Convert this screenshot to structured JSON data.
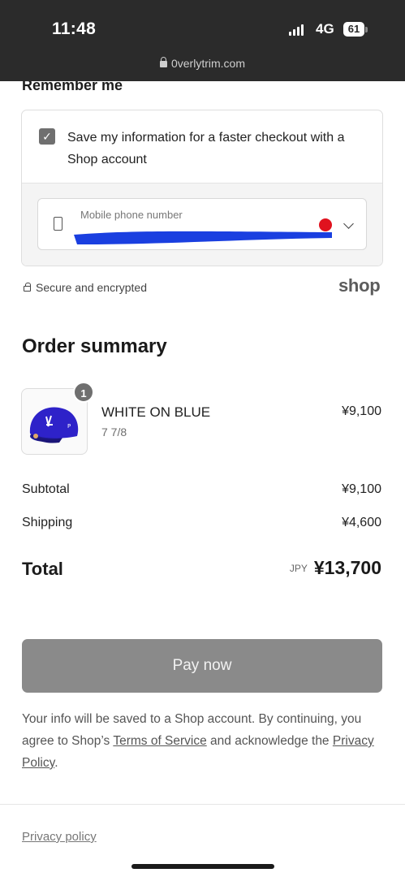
{
  "status_bar": {
    "time": "11:48",
    "network": "4G",
    "battery": "61"
  },
  "browser": {
    "url": "0verlytrim.com"
  },
  "remember_me": {
    "heading": "Remember me",
    "checkbox_checked": true,
    "checkbox_label": "Save my information for a faster checkout with a Shop account",
    "phone_label": "Mobile phone number",
    "phone_value": "",
    "country_flag_color": "#e0121e"
  },
  "secure": {
    "text": "Secure and encrypted",
    "brand": "shop"
  },
  "order_summary": {
    "title": "Order summary",
    "item": {
      "quantity": "1",
      "name": "WHITE ON BLUE",
      "variant": "7 7/8",
      "price": "¥9,100"
    },
    "subtotal_label": "Subtotal",
    "subtotal_value": "¥9,100",
    "shipping_label": "Shipping",
    "shipping_value": "¥4,600",
    "total_label": "Total",
    "currency": "JPY",
    "total_value": "¥13,700"
  },
  "pay_button": {
    "label": "Pay now",
    "color": "#8a8a8a"
  },
  "disclaimer": {
    "before": "Your info will be saved to a Shop account. By continuing, you agree to Shop’s ",
    "terms_link": "Terms of Service",
    "middle": " and acknowledge the ",
    "privacy_link": "Privacy Policy",
    "after": "."
  },
  "footer": {
    "privacy_link": "Privacy policy"
  }
}
